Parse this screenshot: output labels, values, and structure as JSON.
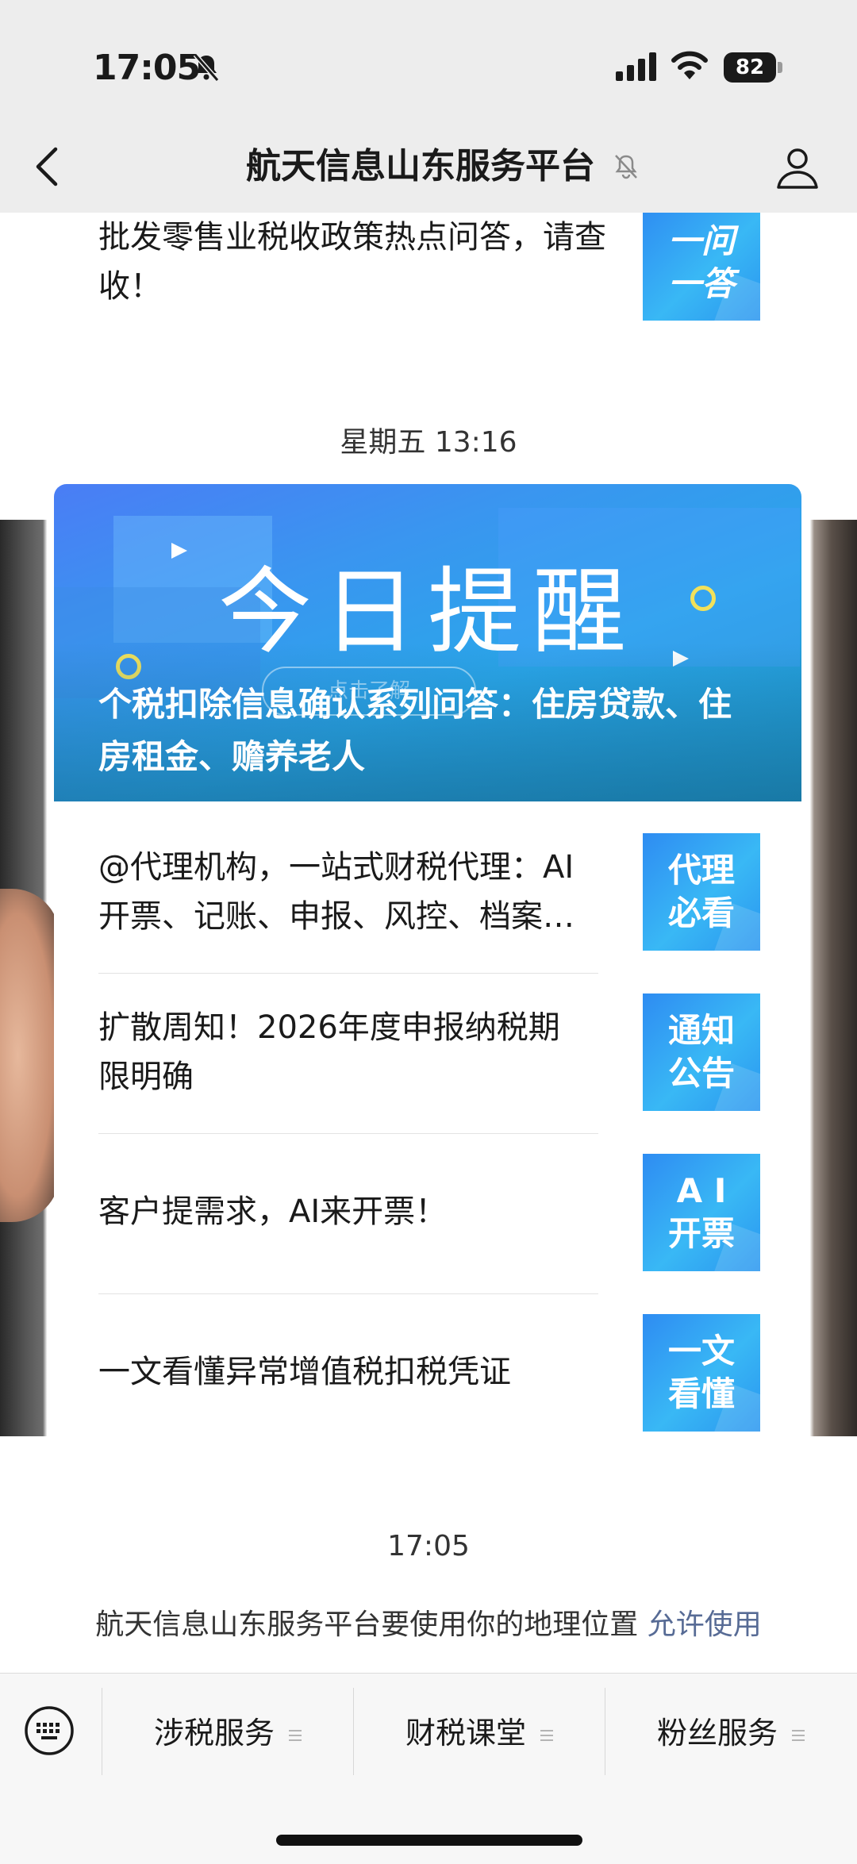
{
  "status_bar": {
    "time": "17:05",
    "battery": "82"
  },
  "nav": {
    "title": "航天信息山东服务平台"
  },
  "previous_article": {
    "title": "批发零售业税收政策热点问答，请查收！",
    "thumb": "一问\n一答"
  },
  "time_separator_1": "星期五 13:16",
  "card": {
    "banner_heading": "今日提醒",
    "banner_cta": "点击了解",
    "banner_title": "个税扣除信息确认系列问答：住房贷款、住房租金、赡养老人",
    "items": [
      {
        "title": "@代理机构，一站式财税代理：AI开票、记账、申报、风控、档案…",
        "thumb": "代理\n必看"
      },
      {
        "title": "扩散周知！2026年度申报纳税期限明确",
        "thumb": "通知\n公告"
      },
      {
        "title": "客户提需求，AI来开票！",
        "thumb": "A I\n开票"
      },
      {
        "title": "一文看懂异常增值税扣税凭证",
        "thumb": "一文\n看懂"
      }
    ]
  },
  "time_separator_2": "17:05",
  "location_request": {
    "message": "航天信息山东服务平台要使用你的地理位置",
    "action": "允许使用"
  },
  "menu": {
    "items": [
      "涉税服务",
      "财税课堂",
      "粉丝服务"
    ]
  },
  "icons": [
    "back-icon",
    "bell-off-icon",
    "signal-icon",
    "wifi-icon",
    "battery-icon",
    "mute-icon",
    "profile-icon",
    "keyboard-icon",
    "menu-lines-icon"
  ]
}
